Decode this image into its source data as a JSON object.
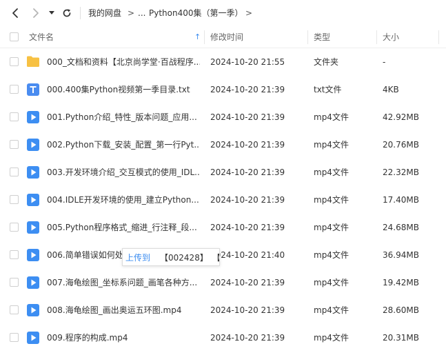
{
  "nav": {
    "back": "back-chevron",
    "forward": "forward-chevron",
    "history": "dropdown-caret",
    "refresh": "refresh-arrow"
  },
  "breadcrumb": {
    "home": "我的网盘",
    "separator": ">",
    "ellipsis": "...",
    "current": "Python400集（第一季）"
  },
  "header": {
    "name": "文件名",
    "modified": "修改时间",
    "type": "类型",
    "size": "大小",
    "sort_indicator": "↑"
  },
  "colors": {
    "folder": "#f7c143",
    "txt": "#4a8cf0",
    "video": "#3d8ef2",
    "accent": "#3b8cf0"
  },
  "files": [
    {
      "icon": "folder-icon",
      "name": "000_文档和资料【北京尚学堂·百战程序...",
      "modified": "2024-10-20 21:55",
      "type": "文件夹",
      "size": "-"
    },
    {
      "icon": "txt-file-icon",
      "name": "000.400集Python视频第一季目录.txt",
      "modified": "2024-10-20 21:39",
      "type": "txt文件",
      "size": "4KB"
    },
    {
      "icon": "video-file-icon",
      "name": "001.Python介绍_特性_版本问题_应用...",
      "modified": "2024-10-20 21:39",
      "type": "mp4文件",
      "size": "42.92MB"
    },
    {
      "icon": "video-file-icon",
      "name": "002.Python下载_安装_配置_第一行Pyt...",
      "modified": "2024-10-20 21:39",
      "type": "mp4文件",
      "size": "20.76MB"
    },
    {
      "icon": "video-file-icon",
      "name": "003.开发环境介绍_交互模式的使用_IDL...",
      "modified": "2024-10-20 21:39",
      "type": "mp4文件",
      "size": "22.32MB"
    },
    {
      "icon": "video-file-icon",
      "name": "004.IDLE开发环境的使用_建立Python...",
      "modified": "2024-10-20 21:39",
      "type": "mp4文件",
      "size": "17.40MB"
    },
    {
      "icon": "video-file-icon",
      "name": "005.Python程序格式_缩进_行注释_段...",
      "modified": "2024-10-20 21:39",
      "type": "mp4文件",
      "size": "24.68MB"
    },
    {
      "icon": "video-file-icon",
      "name": "006.简单错误如何处理_守...",
      "modified": "2024-10-20 21:40",
      "type": "mp4文件",
      "size": "36.94MB"
    },
    {
      "icon": "video-file-icon",
      "name": "007.海龟绘图_坐标系问题_画笔各种方...",
      "modified": "2024-10-20 21:39",
      "type": "mp4文件",
      "size": "19.42MB"
    },
    {
      "icon": "video-file-icon",
      "name": "008.海龟绘图_画出奥运五环图.mp4",
      "modified": "2024-10-20 21:39",
      "type": "mp4文件",
      "size": "28.60MB"
    },
    {
      "icon": "video-file-icon",
      "name": "009.程序的构成.mp4",
      "modified": "2024-10-20 21:39",
      "type": "mp4文件",
      "size": "20.31MB"
    }
  ],
  "tooltip": {
    "upload": "上传到",
    "code": "【002428】",
    "more": "【..."
  }
}
